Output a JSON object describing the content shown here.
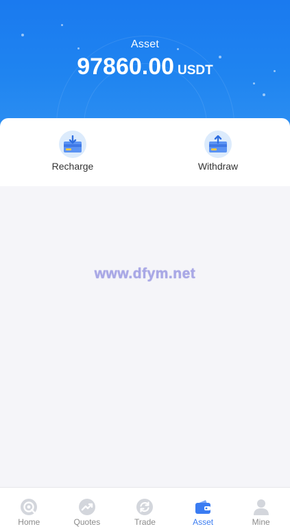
{
  "header": {
    "title": "Asset",
    "balance": "97860.00",
    "unit": "USDT"
  },
  "actions": [
    {
      "label": "Recharge",
      "icon": "recharge-icon"
    },
    {
      "label": "Withdraw",
      "icon": "withdraw-icon"
    }
  ],
  "watermark": "www.dfym.net",
  "tabbar": {
    "active": "Asset",
    "items": [
      {
        "label": "Home",
        "icon": "home-icon"
      },
      {
        "label": "Quotes",
        "icon": "quotes-icon"
      },
      {
        "label": "Trade",
        "icon": "trade-icon"
      },
      {
        "label": "Asset",
        "icon": "wallet-icon"
      },
      {
        "label": "Mine",
        "icon": "user-icon"
      }
    ]
  },
  "colors": {
    "header_gradient_top": "#1a7aef",
    "header_gradient_bottom": "#2d8ff2",
    "active_tab": "#3a7cf2",
    "inactive_tab": "#8a8a8a",
    "page_background": "#f5f5f9"
  }
}
